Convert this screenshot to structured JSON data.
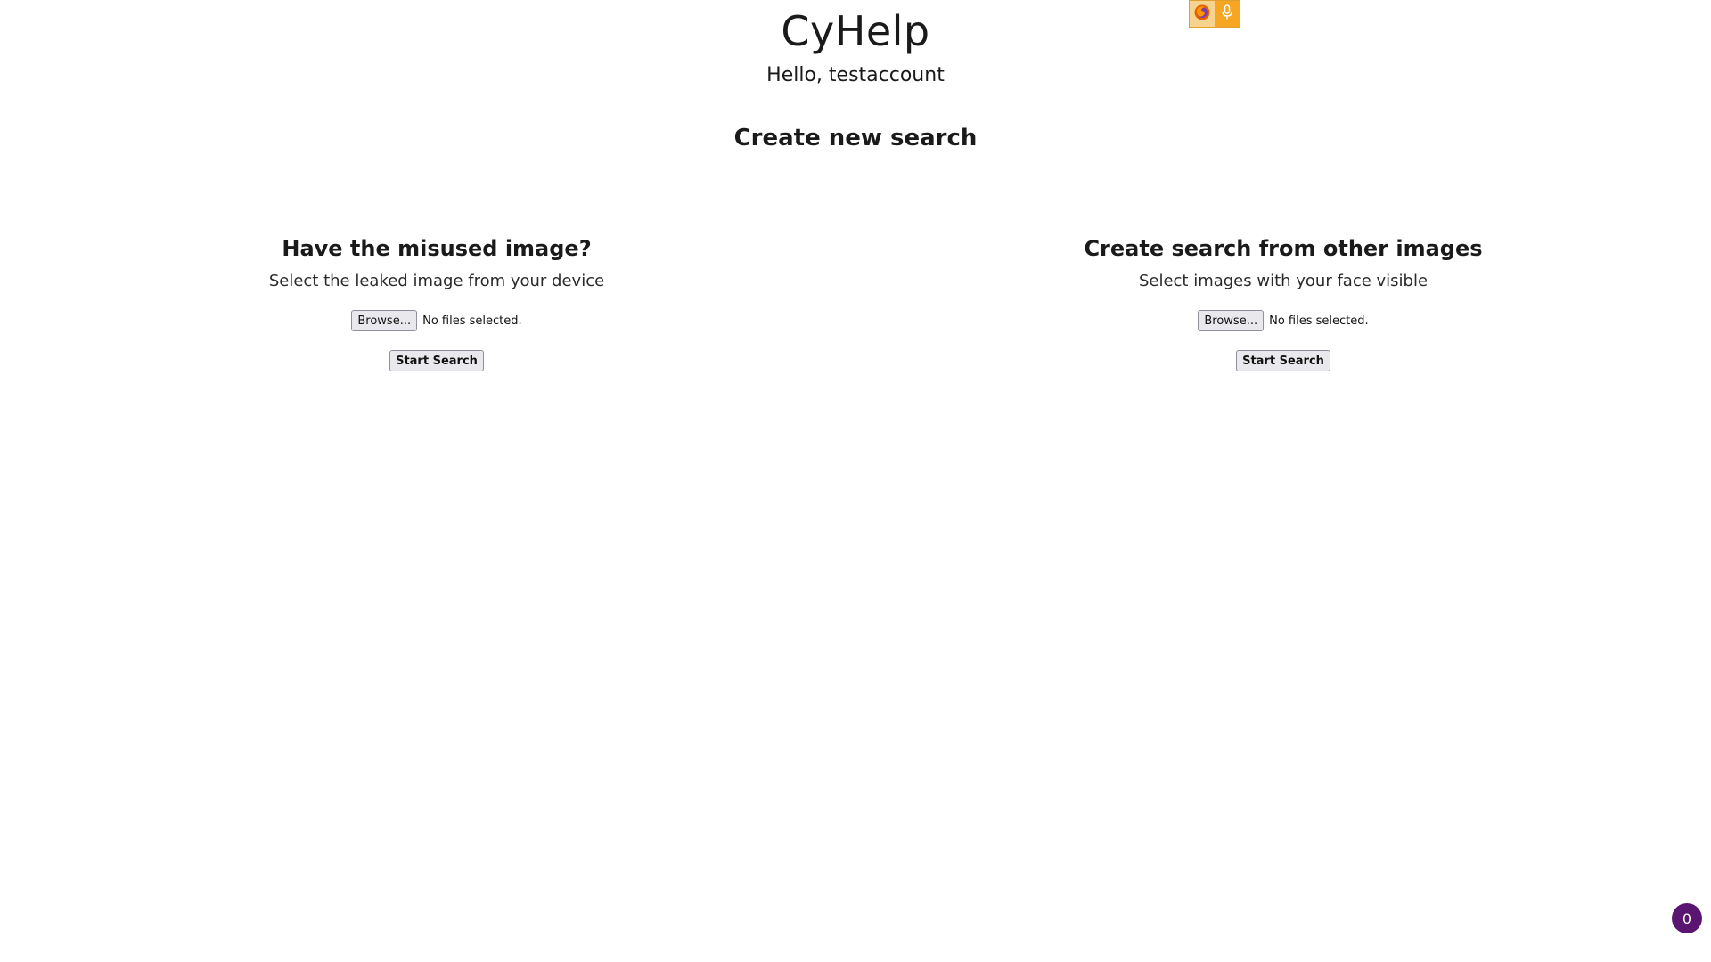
{
  "app": {
    "title": "CyHelp",
    "greeting": "Hello, testaccount",
    "section_title": "Create new search"
  },
  "extension_toolbar": {
    "icons": [
      "firefox-icon",
      "microphone-icon"
    ],
    "colors": {
      "firefox_bg": "#f6d48f",
      "mic_bg": "#f6a623"
    }
  },
  "misused_image": {
    "heading": "Have the misused image?",
    "subtitle": "Select the leaked image from your device",
    "browse_label": "Browse...",
    "file_status": "No files selected.",
    "start_label": "Start Search"
  },
  "other_images": {
    "heading": "Create search from other images",
    "subtitle": "Select images with your face visible",
    "browse_label": "Browse...",
    "file_status": "No files selected.",
    "start_label": "Start Search"
  },
  "badge": {
    "count": "0",
    "color": "#5a1570"
  }
}
